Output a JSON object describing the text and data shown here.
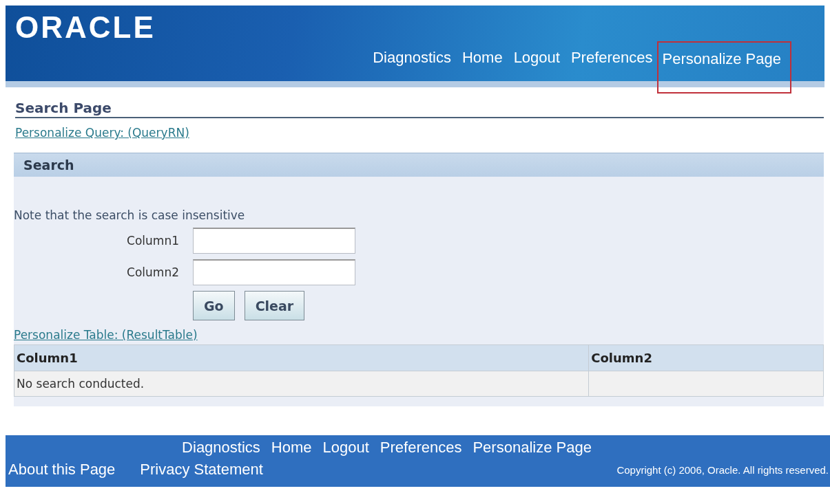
{
  "header": {
    "logo": "ORACLE",
    "nav": [
      {
        "label": "Diagnostics",
        "highlighted": false
      },
      {
        "label": "Home",
        "highlighted": false
      },
      {
        "label": "Logout",
        "highlighted": false
      },
      {
        "label": "Preferences",
        "highlighted": false
      },
      {
        "label": "Personalize Page",
        "highlighted": true
      }
    ]
  },
  "page_title": "Search Page",
  "personalize_query_link": "Personalize Query: (QueryRN)",
  "search": {
    "title": "Search",
    "note": "Note that the search is case insensitive",
    "fields": [
      {
        "label": "Column1"
      },
      {
        "label": "Column2"
      }
    ],
    "buttons": [
      "Go",
      "Clear"
    ]
  },
  "personalize_table_link": "Personalize Table: (ResultTable)",
  "table": {
    "columns": [
      "Column1",
      "Column2"
    ],
    "empty_message": "No search conducted."
  },
  "footer": {
    "nav": [
      "Diagnostics",
      "Home",
      "Logout",
      "Preferences",
      "Personalize Page"
    ],
    "links": [
      "About this Page",
      "Privacy Statement"
    ],
    "copyright": "Copyright (c) 2006, Oracle. All rights reserved."
  }
}
